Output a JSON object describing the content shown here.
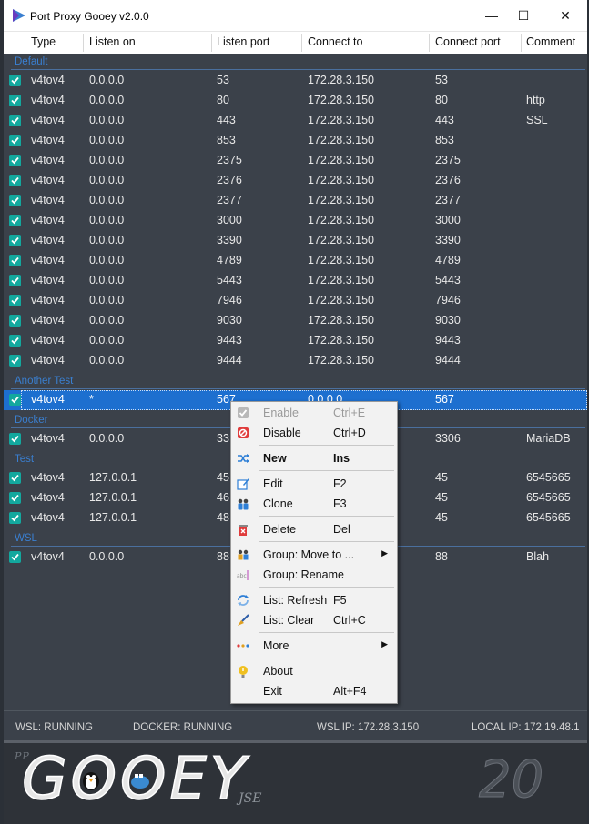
{
  "window": {
    "title": "Port Proxy Gooey  v2.0.0",
    "minimize": "—",
    "maximize": "☐",
    "close": "✕"
  },
  "columns": [
    "Type",
    "Listen on",
    "Listen port",
    "Connect to",
    "Connect port",
    "Comment"
  ],
  "groups": [
    {
      "name": "Default",
      "rows": [
        {
          "type": "v4tov4",
          "listen_on": "0.0.0.0",
          "listen_port": "53",
          "connect_to": "172.28.3.150",
          "connect_port": "53",
          "comment": ""
        },
        {
          "type": "v4tov4",
          "listen_on": "0.0.0.0",
          "listen_port": "80",
          "connect_to": "172.28.3.150",
          "connect_port": "80",
          "comment": "http"
        },
        {
          "type": "v4tov4",
          "listen_on": "0.0.0.0",
          "listen_port": "443",
          "connect_to": "172.28.3.150",
          "connect_port": "443",
          "comment": "SSL"
        },
        {
          "type": "v4tov4",
          "listen_on": "0.0.0.0",
          "listen_port": "853",
          "connect_to": "172.28.3.150",
          "connect_port": "853",
          "comment": ""
        },
        {
          "type": "v4tov4",
          "listen_on": "0.0.0.0",
          "listen_port": "2375",
          "connect_to": "172.28.3.150",
          "connect_port": "2375",
          "comment": ""
        },
        {
          "type": "v4tov4",
          "listen_on": "0.0.0.0",
          "listen_port": "2376",
          "connect_to": "172.28.3.150",
          "connect_port": "2376",
          "comment": ""
        },
        {
          "type": "v4tov4",
          "listen_on": "0.0.0.0",
          "listen_port": "2377",
          "connect_to": "172.28.3.150",
          "connect_port": "2377",
          "comment": ""
        },
        {
          "type": "v4tov4",
          "listen_on": "0.0.0.0",
          "listen_port": "3000",
          "connect_to": "172.28.3.150",
          "connect_port": "3000",
          "comment": ""
        },
        {
          "type": "v4tov4",
          "listen_on": "0.0.0.0",
          "listen_port": "3390",
          "connect_to": "172.28.3.150",
          "connect_port": "3390",
          "comment": ""
        },
        {
          "type": "v4tov4",
          "listen_on": "0.0.0.0",
          "listen_port": "4789",
          "connect_to": "172.28.3.150",
          "connect_port": "4789",
          "comment": ""
        },
        {
          "type": "v4tov4",
          "listen_on": "0.0.0.0",
          "listen_port": "5443",
          "connect_to": "172.28.3.150",
          "connect_port": "5443",
          "comment": ""
        },
        {
          "type": "v4tov4",
          "listen_on": "0.0.0.0",
          "listen_port": "7946",
          "connect_to": "172.28.3.150",
          "connect_port": "7946",
          "comment": ""
        },
        {
          "type": "v4tov4",
          "listen_on": "0.0.0.0",
          "listen_port": "9030",
          "connect_to": "172.28.3.150",
          "connect_port": "9030",
          "comment": ""
        },
        {
          "type": "v4tov4",
          "listen_on": "0.0.0.0",
          "listen_port": "9443",
          "connect_to": "172.28.3.150",
          "connect_port": "9443",
          "comment": ""
        },
        {
          "type": "v4tov4",
          "listen_on": "0.0.0.0",
          "listen_port": "9444",
          "connect_to": "172.28.3.150",
          "connect_port": "9444",
          "comment": ""
        }
      ]
    },
    {
      "name": "Another Test",
      "rows": [
        {
          "type": "v4tov4",
          "listen_on": "*",
          "listen_port": "567",
          "connect_to": "0.0.0.0",
          "connect_port": "567",
          "comment": "",
          "selected": true
        }
      ]
    },
    {
      "name": "Docker",
      "rows": [
        {
          "type": "v4tov4",
          "listen_on": "0.0.0.0",
          "listen_port": "33",
          "connect_to": "",
          "connect_port": "3306",
          "comment": "MariaDB"
        }
      ]
    },
    {
      "name": "Test",
      "rows": [
        {
          "type": "v4tov4",
          "listen_on": "127.0.0.1",
          "listen_port": "45",
          "connect_to": "",
          "connect_port": "45",
          "comment": "6545665"
        },
        {
          "type": "v4tov4",
          "listen_on": "127.0.0.1",
          "listen_port": "46",
          "connect_to": "",
          "connect_port": "45",
          "comment": "6545665"
        },
        {
          "type": "v4tov4",
          "listen_on": "127.0.0.1",
          "listen_port": "48",
          "connect_to": "",
          "connect_port": "45",
          "comment": "6545665"
        }
      ]
    },
    {
      "name": "WSL",
      "rows": [
        {
          "type": "v4tov4",
          "listen_on": "0.0.0.0",
          "listen_port": "88",
          "connect_to": "",
          "connect_port": "88",
          "comment": "Blah"
        }
      ]
    }
  ],
  "context_menu": {
    "items": [
      {
        "label": "Enable",
        "shortcut": "Ctrl+E",
        "icon": "check-icon",
        "disabled": true
      },
      {
        "label": "Disable",
        "shortcut": "Ctrl+D",
        "icon": "disable-icon"
      },
      {
        "separator": true
      },
      {
        "label": "New",
        "shortcut": "Ins",
        "icon": "shuffle-icon",
        "bold": true
      },
      {
        "separator": true
      },
      {
        "label": "Edit",
        "shortcut": "F2",
        "icon": "edit-icon"
      },
      {
        "label": "Clone",
        "shortcut": "F3",
        "icon": "clone-icon"
      },
      {
        "separator": true
      },
      {
        "label": "Delete",
        "shortcut": "Del",
        "icon": "trash-icon"
      },
      {
        "separator": true
      },
      {
        "label": "Group: Move to ...",
        "shortcut": "",
        "icon": "move-group-icon",
        "submenu": true
      },
      {
        "label": "Group: Rename",
        "shortcut": "",
        "icon": "rename-icon"
      },
      {
        "separator": true
      },
      {
        "label": "List: Refresh",
        "shortcut": "F5",
        "icon": "refresh-icon"
      },
      {
        "label": "List: Clear",
        "shortcut": "Ctrl+C",
        "icon": "broom-icon"
      },
      {
        "separator": true
      },
      {
        "label": "More",
        "shortcut": "",
        "icon": "dots-icon",
        "submenu": true
      },
      {
        "separator": true
      },
      {
        "label": "About",
        "shortcut": "",
        "icon": "info-icon"
      },
      {
        "label": "Exit",
        "shortcut": "Alt+F4",
        "icon": ""
      }
    ]
  },
  "status": {
    "wsl": "WSL: RUNNING",
    "docker": "DOCKER: RUNNING",
    "wsl_ip": "WSL IP: 172.28.3.150",
    "local_ip": "LOCAL IP: 172.19.48.1"
  },
  "banner": {
    "pp": "PP",
    "gooey": "GOOEY",
    "jse": "JSE",
    "version": "20"
  },
  "colors": {
    "accent": "#13a89e",
    "selection": "#1d6fcf",
    "group_label": "#3a7fd0",
    "background": "#3b414a"
  }
}
